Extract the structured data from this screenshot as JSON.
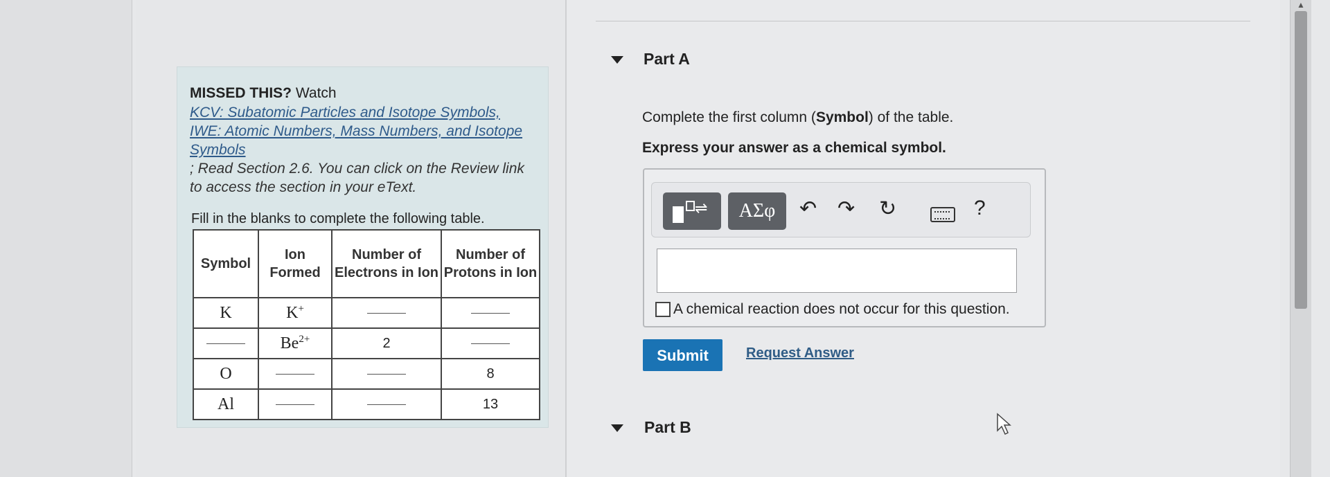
{
  "left_box": {
    "missed_bold": "MISSED THIS?",
    "missed_rest": " Watch",
    "links": [
      "KCV: Subatomic Particles and Isotope Symbols,",
      "IWE: Atomic Numbers, Mass Numbers, and Isotope Symbols"
    ],
    "note": "; Read Section 2.6. You can click on the Review link to access the section in your eText.",
    "fill_label": "Fill in the blanks to complete the following table.",
    "table": {
      "headers": [
        "Symbol",
        "Ion Formed",
        "Number of Electrons in Ion",
        "Number of Protons in Ion"
      ],
      "rows": [
        {
          "symbol": "K",
          "ion_base": "K",
          "ion_charge": "+",
          "electrons": "",
          "protons": ""
        },
        {
          "symbol": "",
          "ion_base": "Be",
          "ion_charge": "2+",
          "electrons": "2",
          "protons": ""
        },
        {
          "symbol": "O",
          "ion_base": "",
          "ion_charge": "",
          "electrons": "",
          "protons": "8"
        },
        {
          "symbol": "Al",
          "ion_base": "",
          "ion_charge": "",
          "electrons": "",
          "protons": "13"
        }
      ]
    }
  },
  "part_a": {
    "title": "Part A",
    "instruction_pre": "Complete the first column (",
    "instruction_bold": "Symbol",
    "instruction_post": ") of the table.",
    "express": "Express your answer as a chemical symbol.",
    "toolbar": {
      "greek_label": "ΑΣφ",
      "icons": [
        "templates-icon",
        "greek-symbols-icon",
        "undo-icon",
        "redo-icon",
        "reset-icon",
        "keyboard-icon",
        "help-icon"
      ],
      "help_label": "?"
    },
    "checkbox_label": "A chemical reaction does not occur for this question.",
    "submit_label": "Submit",
    "request_label": "Request Answer"
  },
  "part_b": {
    "title": "Part B"
  },
  "colors": {
    "submit": "#1a73b4",
    "link": "#2e5a8a",
    "info_box": "#dae6e8"
  }
}
